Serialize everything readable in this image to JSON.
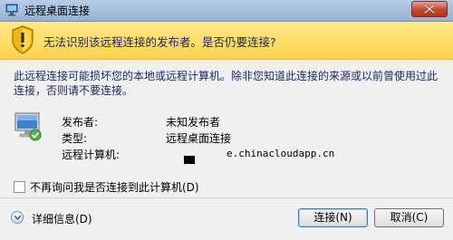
{
  "window": {
    "title": "远程桌面连接"
  },
  "banner": {
    "headline": "无法识别该远程连接的发布者。是否仍要连接?"
  },
  "description": {
    "line1": "此远程连接可能损坏您的本地或远程计算机。除非您知道此连接的来源或以前曾使用过此",
    "line2": "连接，否则请不要连接。"
  },
  "info": {
    "publisher_label": "发布者:",
    "publisher_value": "未知发布者",
    "type_label": "类型:",
    "type_value": "远程桌面连接",
    "remote_label": "远程计算机:",
    "remote_value": "e.chinacloudapp.cn"
  },
  "checkbox": {
    "label": "不再询问我是否连接到此计算机(D)",
    "checked": false
  },
  "details": {
    "label": "详细信息(D)"
  },
  "buttons": {
    "connect": "连接(N)",
    "cancel": "取消(C)"
  },
  "colors": {
    "banner": "#fcd24a",
    "titlebar": "#93b1d6",
    "close": "#c5462e"
  }
}
